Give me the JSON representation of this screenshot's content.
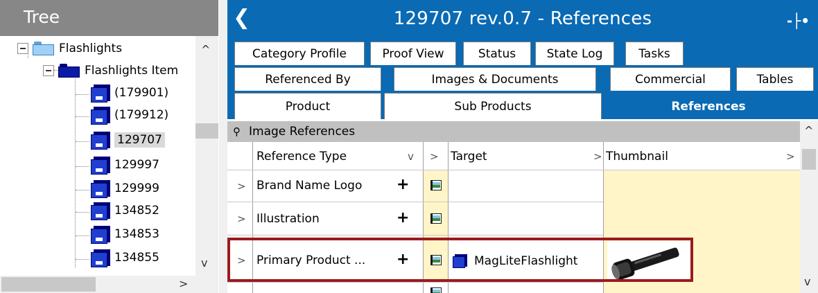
{
  "tree": {
    "header": "Tree",
    "root_label": "Flashlights",
    "group_label": "Flashlights Item",
    "items": [
      {
        "label": "(179901)"
      },
      {
        "label": "(179912)"
      },
      {
        "label": "129707",
        "selected": true
      },
      {
        "label": "129997"
      },
      {
        "label": "129999"
      },
      {
        "label": "134852"
      },
      {
        "label": "134853"
      },
      {
        "label": "134855"
      }
    ],
    "scroll_up": "^",
    "scroll_down": "v",
    "scroll_right": ">"
  },
  "window": {
    "back_icon": "chevron-left-icon",
    "title": "129707 rev.0.7 - References",
    "pin_icon": "pin-icon"
  },
  "tabs": {
    "row1": [
      {
        "label": "Category Profile"
      },
      {
        "label": "Proof View"
      },
      {
        "label": "Status"
      },
      {
        "label": "State Log"
      },
      {
        "label": "Tasks"
      }
    ],
    "row2": [
      {
        "label": "Referenced By"
      },
      {
        "label": "Images & Documents"
      },
      {
        "label": "Commercial"
      },
      {
        "label": "Tables"
      }
    ],
    "row3": [
      {
        "label": "Product"
      },
      {
        "label": "Sub Products"
      },
      {
        "label": "References",
        "active": true
      }
    ]
  },
  "section": {
    "title": "Image References",
    "columns": {
      "reference_type": "Reference Type",
      "target": "Target",
      "thumbnail": "Thumbnail"
    },
    "rows": [
      {
        "type": "Brand Name Logo",
        "target": ""
      },
      {
        "type": "Illustration",
        "target": ""
      },
      {
        "type": "Primary Product ...",
        "target": "MagLiteFlashlight",
        "highlighted": true
      }
    ],
    "add_symbol": "+",
    "expand_symbol": ">",
    "dropdown_symbol": "v"
  },
  "colors": {
    "accent": "#0a6ab4",
    "tree_header": "#878787",
    "highlight_border": "#9b1b1e",
    "thumbnail_bg": "#fff5c8"
  }
}
